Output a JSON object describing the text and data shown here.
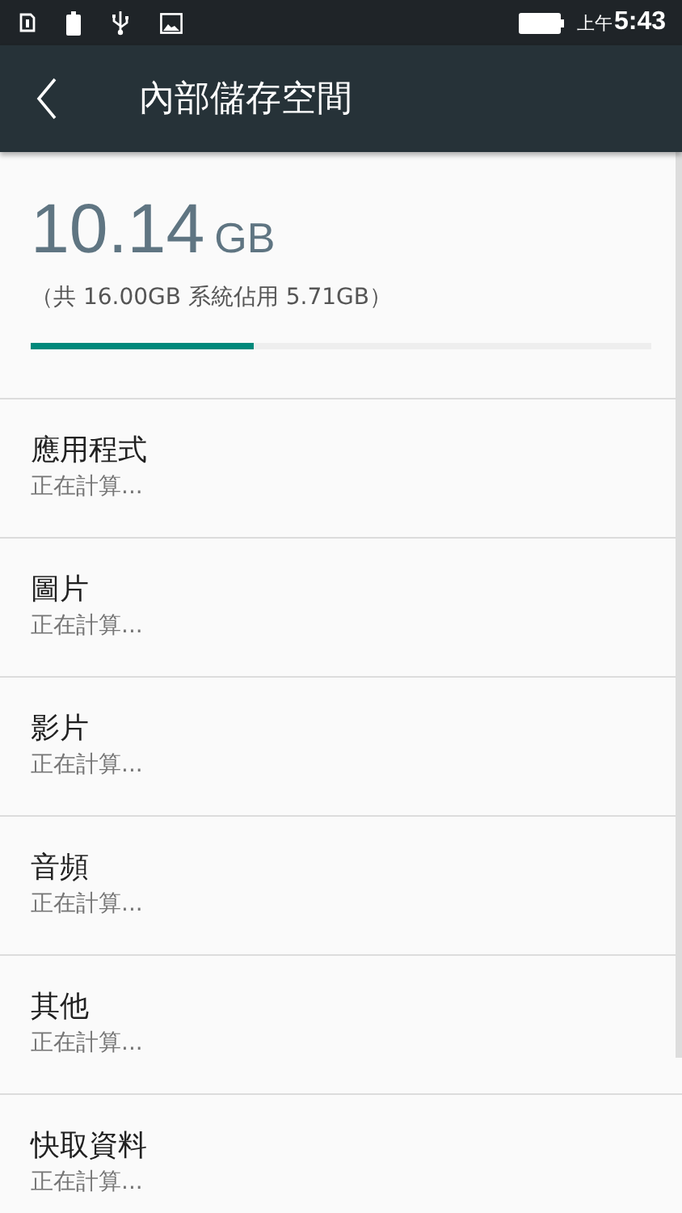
{
  "status_bar": {
    "time_prefix": "上午",
    "time": "5:43"
  },
  "toolbar": {
    "title": "內部儲存空間"
  },
  "summary": {
    "used": "10.14",
    "unit": "GB",
    "detail": "（共 16.00GB 系統佔用 5.71GB）",
    "level": 0.36
  },
  "items": [
    {
      "title": "應用程式",
      "subtitle": "正在計算..."
    },
    {
      "title": "圖片",
      "subtitle": "正在計算..."
    },
    {
      "title": "影片",
      "subtitle": "正在計算..."
    },
    {
      "title": "音頻",
      "subtitle": "正在計算..."
    },
    {
      "title": "其他",
      "subtitle": "正在計算..."
    },
    {
      "title": "快取資料",
      "subtitle": "正在計算..."
    }
  ]
}
